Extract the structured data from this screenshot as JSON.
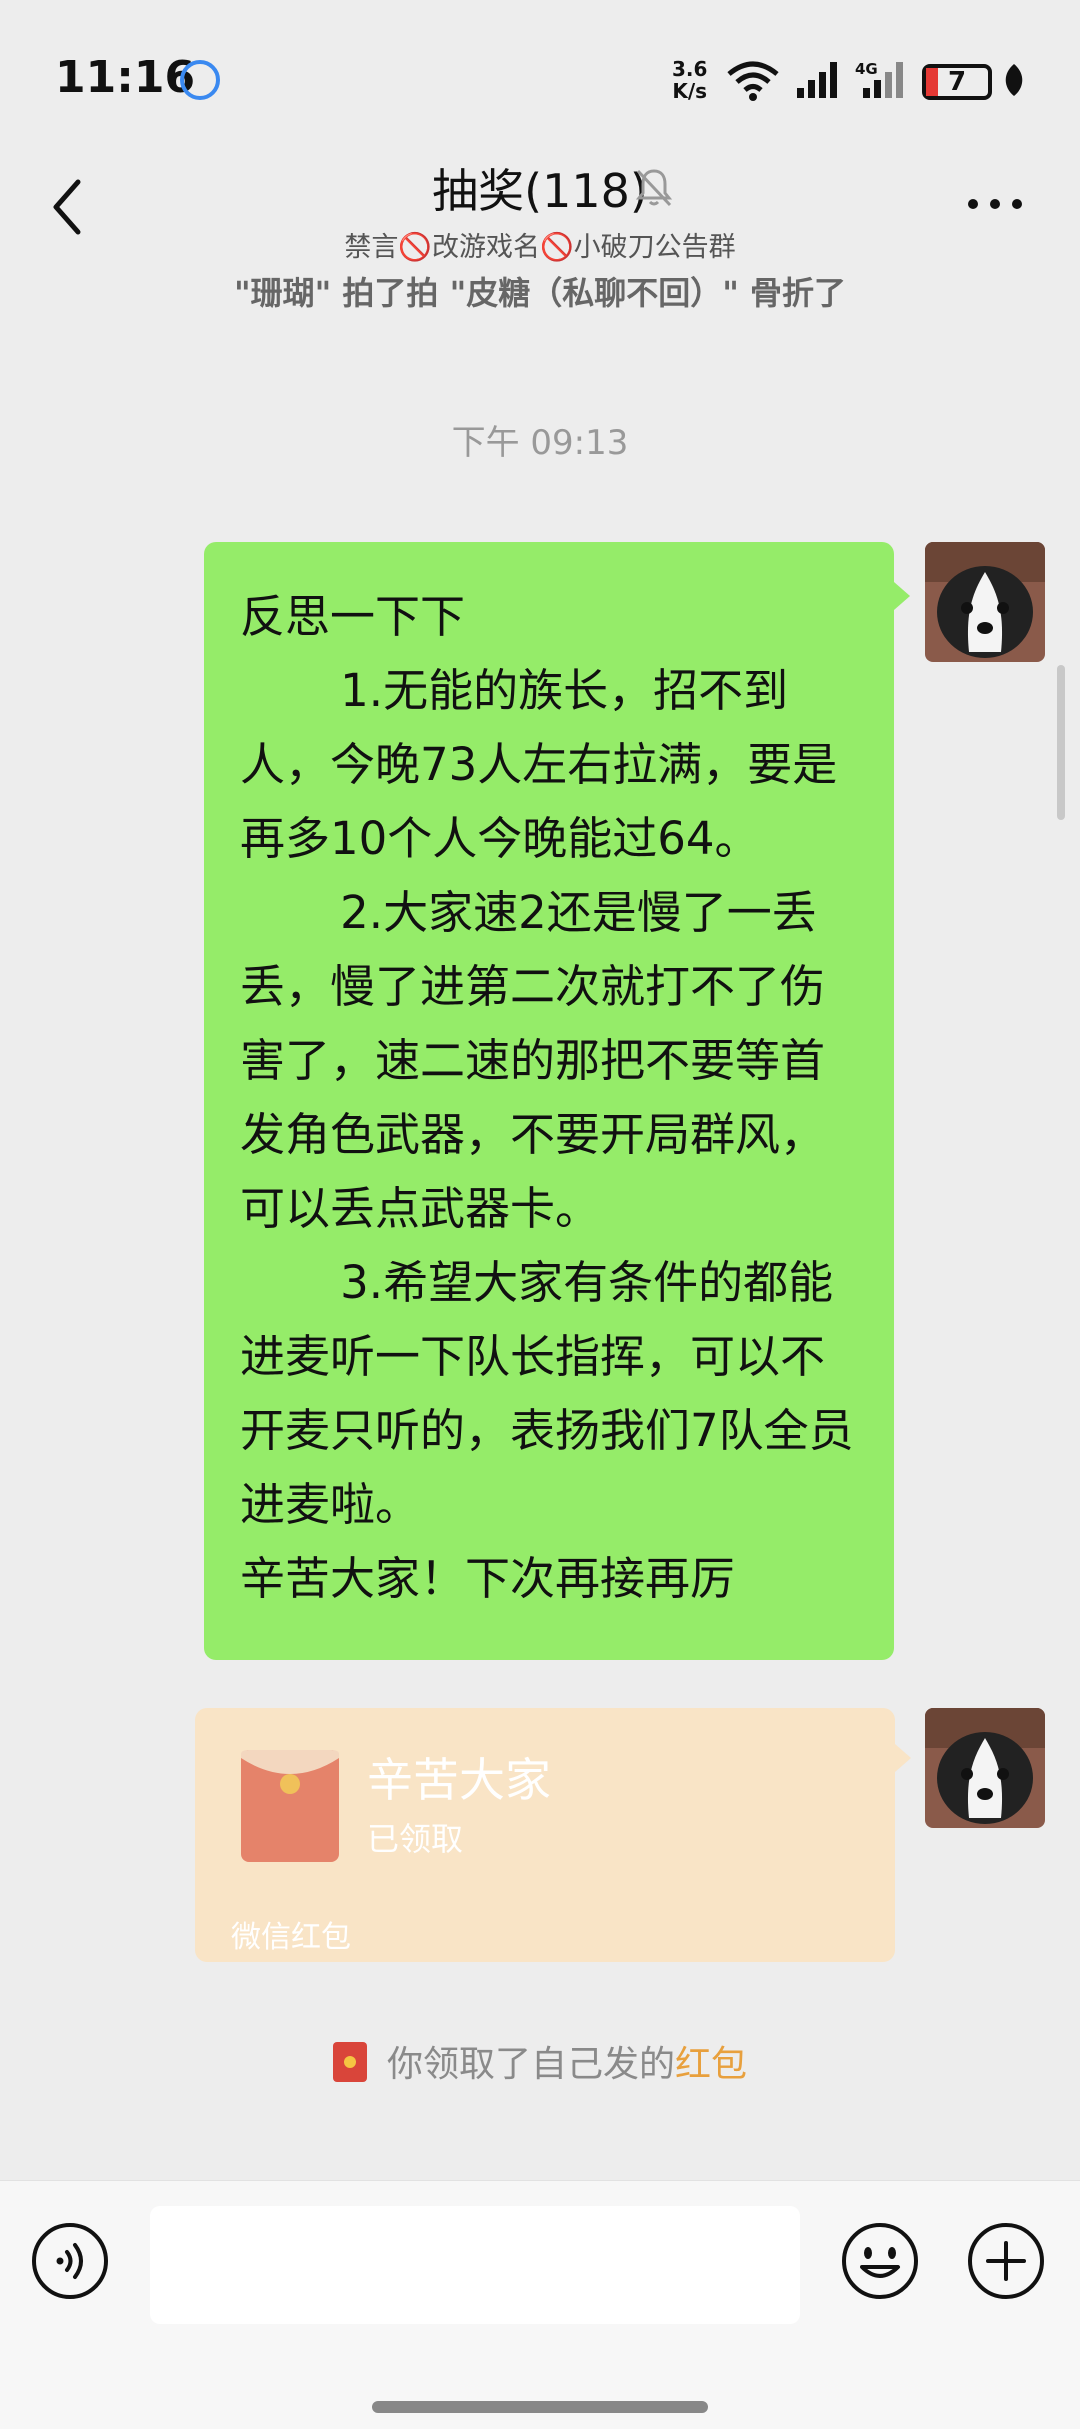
{
  "status_bar": {
    "time": "11:16",
    "net_speed_value": "3.6",
    "net_speed_unit": "K/s",
    "battery": "7",
    "app_icon": "bubble-icon",
    "icons": [
      "wifi-icon",
      "signal-icon",
      "signal-4g-icon",
      "battery-icon",
      "leaf-icon"
    ]
  },
  "header": {
    "title": "抽奖(118)",
    "subtitle": "禁言🚫改游戏名🚫小破刀公告群",
    "back_icon": "chevron-left-icon",
    "mute_icon": "bell-off-icon",
    "more_icon": "more-dots-icon"
  },
  "clipped_notice": "\"珊瑚\" 拍了拍 \"皮糖（私聊不回）\" 骨折了",
  "timestamp": "下午 09:13",
  "messages": [
    {
      "type": "text",
      "sender": "self",
      "avatar": "dog-avatar",
      "text": "反思一下下\n       1.无能的族长，招不到人，今晚73人左右拉满，要是再多10个人今晚能过64。\n       2.大家速2还是慢了一丢丢，慢了进第二次就打不了伤害了，速二速的那把不要等首发角色武器，不要开局群风，可以丢点武器卡。\n       3.希望大家有条件的都能进麦听一下队长指挥，可以不开麦只听的，表扬我们7队全员进麦啦。\n辛苦大家！下次再接再厉"
    },
    {
      "type": "red_packet",
      "sender": "self",
      "avatar": "dog-avatar",
      "title": "辛苦大家",
      "status": "已领取",
      "label": "微信红包"
    }
  ],
  "system_notice": {
    "icon": "red-packet-icon",
    "text": "你领取了自己发的",
    "link": "红包"
  },
  "input_bar": {
    "voice_icon": "voice-icon",
    "emoji_icon": "emoji-icon",
    "plus_icon": "plus-icon",
    "input_value": ""
  },
  "colors": {
    "background": "#ededed",
    "bubble_green": "#95ec69",
    "red_packet_bg": "#f9e4c6",
    "link_orange": "#e8a03d"
  }
}
